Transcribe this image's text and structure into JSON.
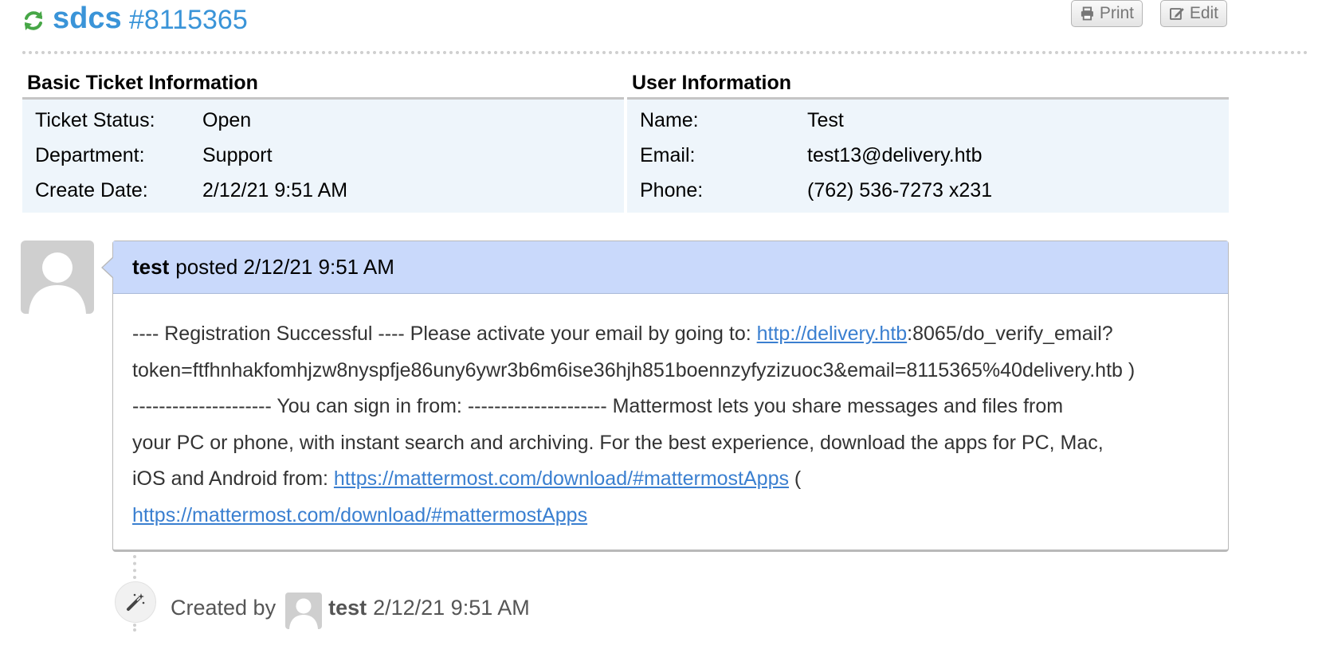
{
  "header": {
    "title": "sdcs",
    "number": "#8115365",
    "print_label": "Print",
    "edit_label": "Edit",
    "accent_color": "#3a94d8",
    "refresh_icon_color": "#46a646"
  },
  "basic_info": {
    "heading": "Basic Ticket Information",
    "rows": [
      {
        "label": "Ticket Status:",
        "value": "Open"
      },
      {
        "label": "Department:",
        "value": "Support"
      },
      {
        "label": "Create Date:",
        "value": "2/12/21 9:51 AM"
      }
    ]
  },
  "user_info": {
    "heading": "User Information",
    "rows": [
      {
        "label": "Name:",
        "value": "Test"
      },
      {
        "label": "Email:",
        "value": "test13@delivery.htb"
      },
      {
        "label": "Phone:",
        "value": "(762) 536-7273 x231"
      }
    ]
  },
  "message": {
    "author": "test",
    "posted_text": "posted 2/12/21 9:51 AM",
    "body": {
      "l1_prefix": "---- Registration Successful ---- Please activate your email by going to: ",
      "l1_link": "http://delivery.htb",
      "l1_suffix": ":8065/do_verify_email?",
      "l2": "token=ftfhnhakfomhjzw8nyspfje86uny6ywr3b6m6ise36hjh851boennzyfyzizuoc3&email=8115365%40delivery.htb )",
      "l3": "--------------------- You can sign in from: --------------------- Mattermost lets you share messages and files from",
      "l4": "your PC or phone, with instant search and archiving. For the best experience, download the apps for PC, Mac,",
      "l5_prefix": "iOS and Android from: ",
      "l5_link": "https://mattermost.com/download/#mattermostApps",
      "l5_suffix": " (",
      "l6_link": "https://mattermost.com/download/#mattermostApps"
    }
  },
  "event": {
    "created_by_label": "Created by",
    "user": "test",
    "timestamp": "2/12/21 9:51 AM"
  }
}
